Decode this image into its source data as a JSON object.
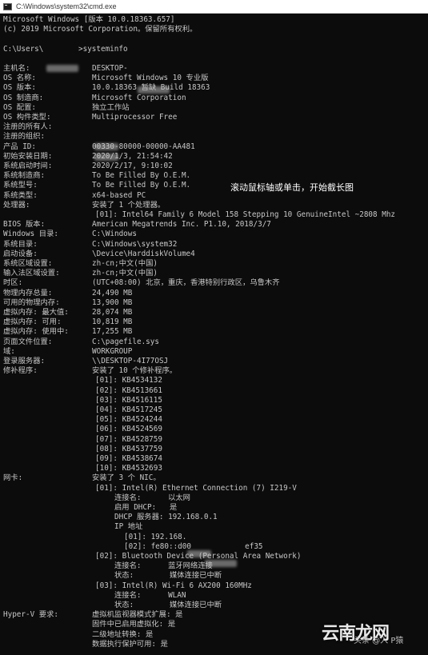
{
  "window": {
    "title": "C:\\Windows\\system32\\cmd.exe",
    "icon": "cmd-icon"
  },
  "overlay_hint": "滚动鼠标轴或单击，开始截长图",
  "watermark": {
    "logo": "云南龙网",
    "sub": "头条 @入 P猿"
  },
  "console": [
    {
      "k": "Microsoft Windows [版本 10.0.18363.657]",
      "v": ""
    },
    {
      "k": "(c) 2019 Microsoft Corporation。保留所有权利。",
      "v": ""
    },
    {
      "k": "",
      "v": ""
    },
    {
      "k": "C:\\Users\\",
      "v": ">systeminfo"
    },
    {
      "k": "",
      "v": ""
    },
    {
      "k": "主机名:",
      "v": "DESKTOP-"
    },
    {
      "k": "OS 名称:",
      "v": "Microsoft Windows 10 专业版"
    },
    {
      "k": "OS 版本:",
      "v": "10.0.18363 暂缺 Build 18363"
    },
    {
      "k": "OS 制造商:",
      "v": "Microsoft Corporation"
    },
    {
      "k": "OS 配置:",
      "v": "独立工作站"
    },
    {
      "k": "OS 构件类型:",
      "v": "Multiprocessor Free"
    },
    {
      "k": "注册的所有人:",
      "v": ""
    },
    {
      "k": "注册的组织:",
      "v": ""
    },
    {
      "k": "产品 ID:",
      "v": "00330-80000-00000-AA481"
    },
    {
      "k": "初始安装日期:",
      "v": "2020/1/3, 21:54:42"
    },
    {
      "k": "系统启动时间:",
      "v": "2020/2/17, 9:10:02"
    },
    {
      "k": "系统制造商:",
      "v": "To Be Filled By O.E.M."
    },
    {
      "k": "系统型号:",
      "v": "To Be Filled By O.E.M."
    },
    {
      "k": "系统类型:",
      "v": "x64-based PC"
    },
    {
      "k": "处理器:",
      "v": "安装了 1 个处理器。"
    },
    {
      "k": "",
      "v": "[01]: Intel64 Family 6 Model 158 Stepping 10 GenuineIntel ~2808 Mhz",
      "indent": 1
    },
    {
      "k": "BIOS 版本:",
      "v": "American Megatrends Inc. P1.10, 2018/3/7"
    },
    {
      "k": "Windows 目录:",
      "v": "C:\\Windows"
    },
    {
      "k": "系统目录:",
      "v": "C:\\Windows\\system32"
    },
    {
      "k": "启动设备:",
      "v": "\\Device\\HarddiskVolume4"
    },
    {
      "k": "系统区域设置:",
      "v": "zh-cn;中文(中国)"
    },
    {
      "k": "输入法区域设置:",
      "v": "zh-cn;中文(中国)"
    },
    {
      "k": "时区:",
      "v": "(UTC+08:00) 北京，重庆，香港特别行政区，乌鲁木齐"
    },
    {
      "k": "物理内存总量:",
      "v": "24,490 MB"
    },
    {
      "k": "可用的物理内存:",
      "v": "13,900 MB"
    },
    {
      "k": "虚拟内存: 最大值:",
      "v": "28,074 MB"
    },
    {
      "k": "虚拟内存: 可用:",
      "v": "10,819 MB"
    },
    {
      "k": "虚拟内存: 使用中:",
      "v": "17,255 MB"
    },
    {
      "k": "页面文件位置:",
      "v": "C:\\pagefile.sys"
    },
    {
      "k": "域:",
      "v": "WORKGROUP"
    },
    {
      "k": "登录服务器:",
      "v": "\\\\DESKTOP-4I77OSJ"
    },
    {
      "k": "修补程序:",
      "v": "安装了 10 个修补程序。"
    },
    {
      "k": "",
      "v": "[01]: KB4534132",
      "indent": 1
    },
    {
      "k": "",
      "v": "[02]: KB4513661",
      "indent": 1
    },
    {
      "k": "",
      "v": "[03]: KB4516115",
      "indent": 1
    },
    {
      "k": "",
      "v": "[04]: KB4517245",
      "indent": 1
    },
    {
      "k": "",
      "v": "[05]: KB4524244",
      "indent": 1
    },
    {
      "k": "",
      "v": "[06]: KB4524569",
      "indent": 1
    },
    {
      "k": "",
      "v": "[07]: KB4528759",
      "indent": 1
    },
    {
      "k": "",
      "v": "[08]: KB4537759",
      "indent": 1
    },
    {
      "k": "",
      "v": "[09]: KB4538674",
      "indent": 1
    },
    {
      "k": "",
      "v": "[10]: KB4532693",
      "indent": 1
    },
    {
      "k": "网卡:",
      "v": "安装了 3 个 NIC。"
    },
    {
      "k": "",
      "v": "[01]: Intel(R) Ethernet Connection (7) I219-V",
      "indent": 1
    },
    {
      "k": "",
      "v": "连接名:      以太网",
      "indent": 2
    },
    {
      "k": "",
      "v": "启用 DHCP:   是",
      "indent": 2
    },
    {
      "k": "",
      "v": "DHCP 服务器: 192.168.0.1",
      "indent": 2
    },
    {
      "k": "",
      "v": "IP 地址",
      "indent": 2
    },
    {
      "k": "",
      "v": "[01]: 192.168.",
      "indent": 3
    },
    {
      "k": "",
      "v": "[02]: fe80::d00            ef35",
      "indent": 3
    },
    {
      "k": "",
      "v": "[02]: Bluetooth Device (Personal Area Network)",
      "indent": 1
    },
    {
      "k": "",
      "v": "连接名:      蓝牙网络连接",
      "indent": 2
    },
    {
      "k": "",
      "v": "状态:        媒体连接已中断",
      "indent": 2
    },
    {
      "k": "",
      "v": "[03]: Intel(R) Wi-Fi 6 AX200 160MHz",
      "indent": 1
    },
    {
      "k": "",
      "v": "连接名:      WLAN",
      "indent": 2
    },
    {
      "k": "",
      "v": "状态:        媒体连接已中断",
      "indent": 2
    },
    {
      "k": "Hyper-V 要求:",
      "v": "虚拟机监视器模式扩展: 是"
    },
    {
      "k": "",
      "v": "固件中已启用虚拟化: 是"
    },
    {
      "k": "",
      "v": "二级地址转换: 是"
    },
    {
      "k": "",
      "v": "数据执行保护可用: 是"
    }
  ]
}
